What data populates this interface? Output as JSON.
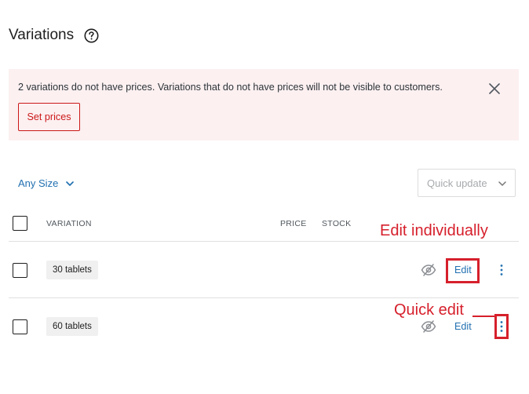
{
  "header": {
    "title": "Variations"
  },
  "notice": {
    "message": "2 variations do not have prices. Variations that do not have prices will not be visible to customers.",
    "button_label": "Set prices"
  },
  "filter": {
    "label": "Any Size"
  },
  "quick_update": {
    "label": "Quick update"
  },
  "table": {
    "columns": [
      "VARIATION",
      "PRICE",
      "STOCK"
    ],
    "rows": [
      {
        "name": "30 tablets",
        "edit_label": "Edit"
      },
      {
        "name": "60 tablets",
        "edit_label": "Edit"
      }
    ]
  },
  "annotations": {
    "edit_individually": "Edit individually",
    "quick_edit": "Quick edit"
  },
  "colors": {
    "accent": "#2271b1",
    "notice_bg": "#fcf0f1",
    "notice_button": "#cc1818",
    "annotation": "#d6202c"
  },
  "icons": {
    "help": "help-circle-icon",
    "close": "close-icon",
    "chevron": "chevron-down-icon",
    "visibility": "eye-slash-icon",
    "more": "kebab-menu-icon"
  }
}
